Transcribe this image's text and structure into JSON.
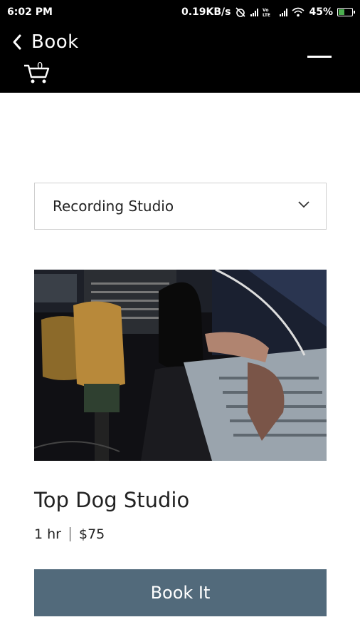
{
  "status_bar": {
    "time": "6:02 PM",
    "network_speed": "0.19KB/s",
    "volte_label": "Vo LTE",
    "battery": "45%",
    "battery_level": 0.45
  },
  "header": {
    "back_icon": "chevron-left-icon",
    "title": "Book",
    "cart_count": "0",
    "menu_icon": "hamburger-menu-icon"
  },
  "service_select": {
    "selected": "Recording Studio"
  },
  "service": {
    "name": "Top Dog Studio",
    "duration": "1 hr",
    "price": "$75"
  },
  "book_button": {
    "label": "Book It",
    "color": "#526a7b"
  }
}
